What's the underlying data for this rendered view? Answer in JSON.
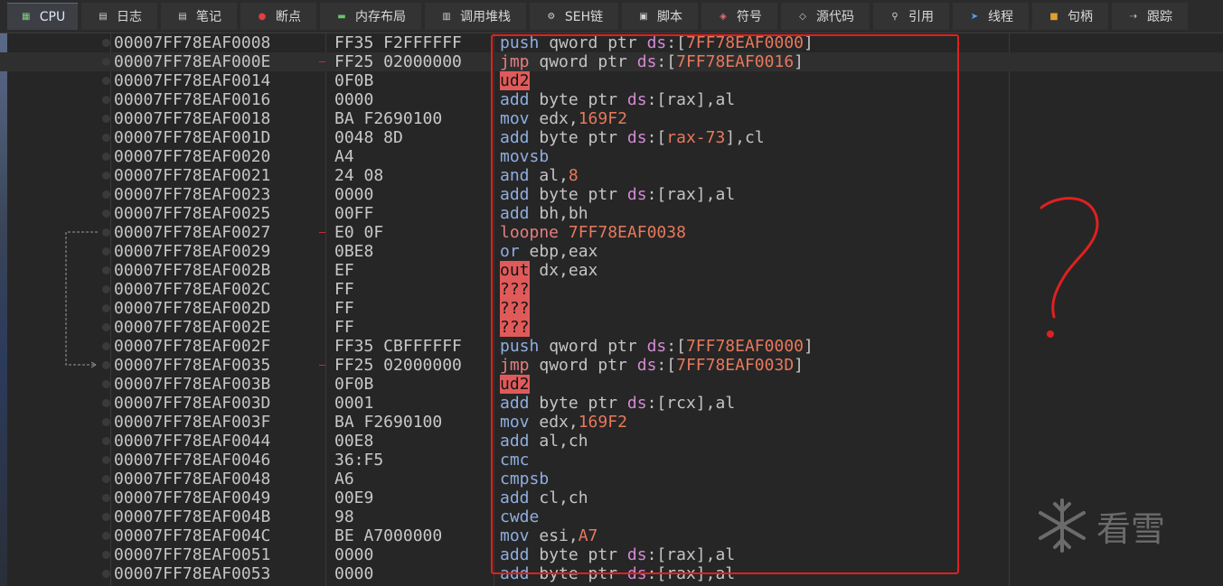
{
  "tabs": [
    {
      "label": "CPU",
      "icon": "cpu-icon",
      "active": true
    },
    {
      "label": "日志",
      "icon": "log-icon"
    },
    {
      "label": "笔记",
      "icon": "notes-icon"
    },
    {
      "label": "断点",
      "icon": "breakpoint-icon"
    },
    {
      "label": "内存布局",
      "icon": "memory-map-icon"
    },
    {
      "label": "调用堆栈",
      "icon": "call-stack-icon"
    },
    {
      "label": "SEH链",
      "icon": "seh-icon"
    },
    {
      "label": "脚本",
      "icon": "script-icon"
    },
    {
      "label": "符号",
      "icon": "symbols-icon"
    },
    {
      "label": "源代码",
      "icon": "source-icon"
    },
    {
      "label": "引用",
      "icon": "references-icon"
    },
    {
      "label": "线程",
      "icon": "threads-icon"
    },
    {
      "label": "句柄",
      "icon": "handles-icon"
    },
    {
      "label": "跟踪",
      "icon": "trace-icon"
    }
  ],
  "rows": [
    {
      "addr": "00007FF78EAF0008",
      "bytes": "FF35 F2FFFFFF",
      "mnem": "push",
      "ops": [
        {
          "t": "qword ptr ",
          "c": "reg"
        },
        {
          "t": "ds",
          "c": "kw"
        },
        {
          "t": ":[",
          "c": "reg"
        },
        {
          "t": "7FF78EAF0000",
          "c": "num"
        },
        {
          "t": "]",
          "c": "reg"
        }
      ]
    },
    {
      "addr": "00007FF78EAF000E",
      "bytes": "FF25 02000000",
      "mnem": "jmp",
      "mstyle": "jmp",
      "marker": true,
      "selected": true,
      "ops": [
        {
          "t": "qword ptr ",
          "c": "reg"
        },
        {
          "t": "ds",
          "c": "kw"
        },
        {
          "t": ":[",
          "c": "reg"
        },
        {
          "t": "7FF78EAF0016",
          "c": "num"
        },
        {
          "t": "]",
          "c": "reg"
        }
      ]
    },
    {
      "addr": "00007FF78EAF0014",
      "bytes": "0F0B",
      "mnem": "ud2",
      "mstyle": "bad",
      "ops": []
    },
    {
      "addr": "00007FF78EAF0016",
      "bytes": "0000",
      "mnem": "add",
      "ops": [
        {
          "t": "byte ptr ",
          "c": "reg"
        },
        {
          "t": "ds",
          "c": "kw"
        },
        {
          "t": ":[",
          "c": "reg"
        },
        {
          "t": "rax",
          "c": "reg"
        },
        {
          "t": "],",
          "c": "reg"
        },
        {
          "t": "al",
          "c": "reg"
        }
      ]
    },
    {
      "addr": "00007FF78EAF0018",
      "bytes": "BA F2690100",
      "mnem": "mov",
      "ops": [
        {
          "t": "edx,",
          "c": "reg"
        },
        {
          "t": "169F2",
          "c": "num"
        }
      ]
    },
    {
      "addr": "00007FF78EAF001D",
      "bytes": "0048 8D",
      "mnem": "add",
      "ops": [
        {
          "t": "byte ptr ",
          "c": "reg"
        },
        {
          "t": "ds",
          "c": "kw"
        },
        {
          "t": ":[",
          "c": "reg"
        },
        {
          "t": "rax-73",
          "c": "num"
        },
        {
          "t": "],",
          "c": "reg"
        },
        {
          "t": "cl",
          "c": "reg"
        }
      ]
    },
    {
      "addr": "00007FF78EAF0020",
      "bytes": "A4",
      "mnem": "movsb",
      "ops": []
    },
    {
      "addr": "00007FF78EAF0021",
      "bytes": "24 08",
      "mnem": "and",
      "ops": [
        {
          "t": "al,",
          "c": "reg"
        },
        {
          "t": "8",
          "c": "num"
        }
      ]
    },
    {
      "addr": "00007FF78EAF0023",
      "bytes": "0000",
      "mnem": "add",
      "ops": [
        {
          "t": "byte ptr ",
          "c": "reg"
        },
        {
          "t": "ds",
          "c": "kw"
        },
        {
          "t": ":[",
          "c": "reg"
        },
        {
          "t": "rax",
          "c": "reg"
        },
        {
          "t": "],",
          "c": "reg"
        },
        {
          "t": "al",
          "c": "reg"
        }
      ]
    },
    {
      "addr": "00007FF78EAF0025",
      "bytes": "00FF",
      "mnem": "add",
      "ops": [
        {
          "t": "bh,bh",
          "c": "reg"
        }
      ]
    },
    {
      "addr": "00007FF78EAF0027",
      "bytes": "E0 0F",
      "mnem": "loopne",
      "mstyle": "jmp",
      "marker": true,
      "ops": [
        {
          "t": "7FF78EAF0038",
          "c": "num"
        }
      ]
    },
    {
      "addr": "00007FF78EAF0029",
      "bytes": "0BE8",
      "mnem": "or",
      "ops": [
        {
          "t": "ebp,eax",
          "c": "reg"
        }
      ]
    },
    {
      "addr": "00007FF78EAF002B",
      "bytes": "EF",
      "mnem": "out",
      "mstyle": "bad",
      "ops": [
        {
          "t": "dx,eax",
          "c": "reg"
        }
      ]
    },
    {
      "addr": "00007FF78EAF002C",
      "bytes": "FF",
      "mnem": "???",
      "mstyle": "bad",
      "ops": []
    },
    {
      "addr": "00007FF78EAF002D",
      "bytes": "FF",
      "mnem": "???",
      "mstyle": "bad",
      "ops": []
    },
    {
      "addr": "00007FF78EAF002E",
      "bytes": "FF",
      "mnem": "???",
      "mstyle": "bad",
      "ops": []
    },
    {
      "addr": "00007FF78EAF002F",
      "bytes": "FF35 CBFFFFFF",
      "mnem": "push",
      "ops": [
        {
          "t": "qword ptr ",
          "c": "reg"
        },
        {
          "t": "ds",
          "c": "kw"
        },
        {
          "t": ":[",
          "c": "reg"
        },
        {
          "t": "7FF78EAF0000",
          "c": "num"
        },
        {
          "t": "]",
          "c": "reg"
        }
      ]
    },
    {
      "addr": "00007FF78EAF0035",
      "bytes": "FF25 02000000",
      "mnem": "jmp",
      "mstyle": "jmp",
      "marker": true,
      "ops": [
        {
          "t": "qword ptr ",
          "c": "reg"
        },
        {
          "t": "ds",
          "c": "kw"
        },
        {
          "t": ":[",
          "c": "reg"
        },
        {
          "t": "7FF78EAF003D",
          "c": "num"
        },
        {
          "t": "]",
          "c": "reg"
        }
      ]
    },
    {
      "addr": "00007FF78EAF003B",
      "bytes": "0F0B",
      "mnem": "ud2",
      "mstyle": "bad",
      "ops": []
    },
    {
      "addr": "00007FF78EAF003D",
      "bytes": "0001",
      "mnem": "add",
      "ops": [
        {
          "t": "byte ptr ",
          "c": "reg"
        },
        {
          "t": "ds",
          "c": "kw"
        },
        {
          "t": ":[",
          "c": "reg"
        },
        {
          "t": "rcx",
          "c": "reg"
        },
        {
          "t": "],",
          "c": "reg"
        },
        {
          "t": "al",
          "c": "reg"
        }
      ]
    },
    {
      "addr": "00007FF78EAF003F",
      "bytes": "BA F2690100",
      "mnem": "mov",
      "ops": [
        {
          "t": "edx,",
          "c": "reg"
        },
        {
          "t": "169F2",
          "c": "num"
        }
      ]
    },
    {
      "addr": "00007FF78EAF0044",
      "bytes": "00E8",
      "mnem": "add",
      "ops": [
        {
          "t": "al,ch",
          "c": "reg"
        }
      ]
    },
    {
      "addr": "00007FF78EAF0046",
      "bytes": "36:F5",
      "mnem": "cmc",
      "ops": []
    },
    {
      "addr": "00007FF78EAF0048",
      "bytes": "A6",
      "mnem": "cmpsb",
      "ops": []
    },
    {
      "addr": "00007FF78EAF0049",
      "bytes": "00E9",
      "mnem": "add",
      "ops": [
        {
          "t": "cl,ch",
          "c": "reg"
        }
      ]
    },
    {
      "addr": "00007FF78EAF004B",
      "bytes": "98",
      "mnem": "cwde",
      "ops": []
    },
    {
      "addr": "00007FF78EAF004C",
      "bytes": "BE A7000000",
      "mnem": "mov",
      "ops": [
        {
          "t": "esi,",
          "c": "reg"
        },
        {
          "t": "A7",
          "c": "num"
        }
      ]
    },
    {
      "addr": "00007FF78EAF0051",
      "bytes": "0000",
      "mnem": "add",
      "ops": [
        {
          "t": "byte ptr ",
          "c": "reg"
        },
        {
          "t": "ds",
          "c": "kw"
        },
        {
          "t": ":[",
          "c": "reg"
        },
        {
          "t": "rax",
          "c": "reg"
        },
        {
          "t": "],",
          "c": "reg"
        },
        {
          "t": "al",
          "c": "reg"
        }
      ]
    },
    {
      "addr": "00007FF78EAF0053",
      "bytes": "0000",
      "mnem": "add",
      "ops": [
        {
          "t": "byte ptr ",
          "c": "reg"
        },
        {
          "t": "ds",
          "c": "kw"
        },
        {
          "t": ":[",
          "c": "reg"
        },
        {
          "t": "rax",
          "c": "reg"
        },
        {
          "t": "],",
          "c": "reg"
        },
        {
          "t": "al",
          "c": "reg"
        }
      ]
    }
  ],
  "annotation": {
    "box_color": "#e02020"
  },
  "watermark": {
    "text": "看雪",
    "icon": "snowflake-icon"
  }
}
